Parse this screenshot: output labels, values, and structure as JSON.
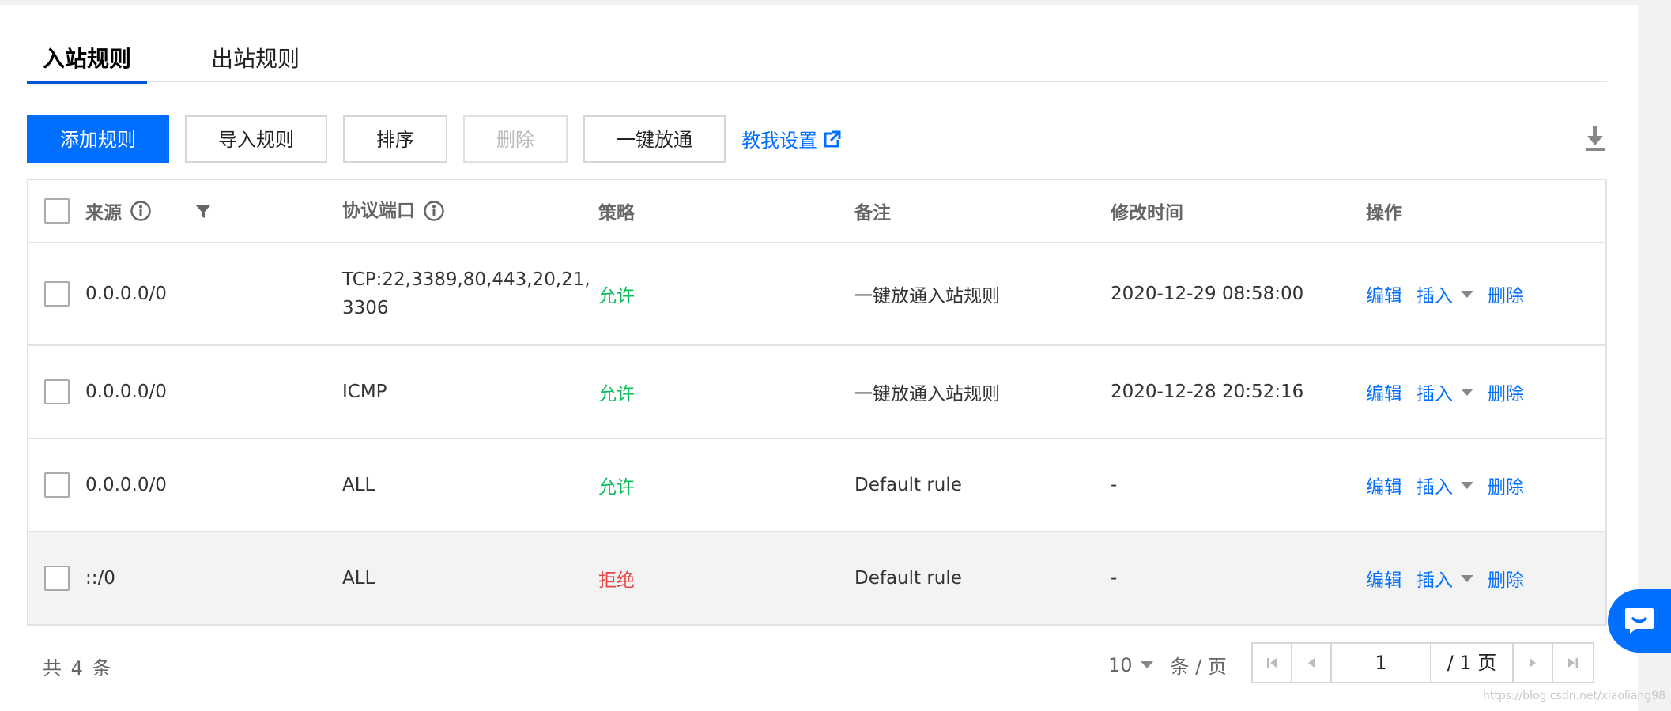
{
  "tabs": [
    {
      "label": "入站规则",
      "active": true
    },
    {
      "label": "出站规则",
      "active": false
    }
  ],
  "toolbar": {
    "add_rule": "添加规则",
    "import_rule": "导入规则",
    "sort": "排序",
    "delete": "删除",
    "one_click_open": "一键放通",
    "help_link": "教我设置"
  },
  "table": {
    "headers": {
      "source": "来源",
      "protocol_port": "协议端口",
      "policy": "策略",
      "remark": "备注",
      "modified_time": "修改时间",
      "actions": "操作"
    },
    "rows": [
      {
        "source": "0.0.0.0/0",
        "port_line1": "TCP:22,3389,80,443,20,21,",
        "port_line2": "3306",
        "policy": "允许",
        "remark": "一键放通入站规则",
        "time": "2020-12-29 08:58:00"
      },
      {
        "source": "0.0.0.0/0",
        "port_line1": "ICMP",
        "port_line2": "",
        "policy": "允许",
        "remark": "一键放通入站规则",
        "time": "2020-12-28 20:52:16"
      },
      {
        "source": "0.0.0.0/0",
        "port_line1": "ALL",
        "port_line2": "",
        "policy": "允许",
        "remark": "Default rule",
        "time": "-"
      },
      {
        "source": "::/0",
        "port_line1": "ALL",
        "port_line2": "",
        "policy": "拒绝",
        "remark": "Default rule",
        "time": "-"
      }
    ],
    "ops": {
      "edit": "编辑",
      "insert": "插入",
      "delete": "删除"
    }
  },
  "footer": {
    "total": "共 4 条",
    "page_size": "10",
    "per_page_unit": "条 / 页",
    "current_page": "1",
    "total_pages": "/ 1 页"
  },
  "watermark": "https://blog.csdn.net/xiaoliang98",
  "colors": {
    "primary": "#006eff",
    "allow": "#0abf5b",
    "deny": "#e54545"
  },
  "icons": [
    "info-icon",
    "filter-icon",
    "external-link-icon",
    "download-icon",
    "caret-down-icon",
    "first-page-icon",
    "prev-page-icon",
    "next-page-icon",
    "last-page-icon",
    "chat-icon"
  ]
}
